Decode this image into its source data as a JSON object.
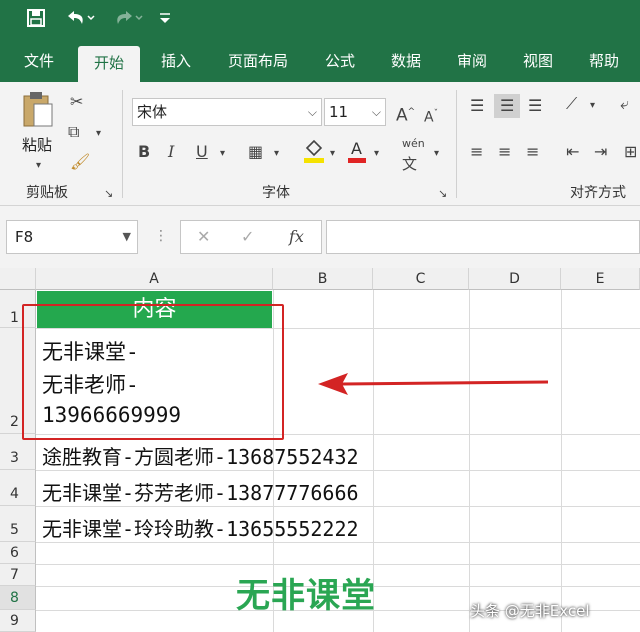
{
  "quick_access": {
    "save_icon": "save-icon",
    "undo_icon": "undo-icon",
    "redo_icon": "redo-icon",
    "customize_icon": "customize-icon"
  },
  "tabs": [
    {
      "label": "文件"
    },
    {
      "label": "开始",
      "active": true
    },
    {
      "label": "插入"
    },
    {
      "label": "页面布局"
    },
    {
      "label": "公式"
    },
    {
      "label": "数据"
    },
    {
      "label": "审阅"
    },
    {
      "label": "视图"
    },
    {
      "label": "帮助"
    }
  ],
  "ribbon": {
    "clipboard": {
      "paste_label": "粘贴",
      "group_label": "剪贴板"
    },
    "font": {
      "name": "宋体",
      "size": "11",
      "group_label": "字体",
      "bold": "B",
      "italic": "I",
      "underline": "U",
      "grow": "A",
      "shrink": "A",
      "font_color": "A",
      "phonetic": "wén"
    },
    "alignment": {
      "group_label": "对齐方式"
    }
  },
  "formula_bar": {
    "name_box": "F8",
    "fx": "fx",
    "formula": ""
  },
  "sheet": {
    "columns": [
      "A",
      "B",
      "C",
      "D",
      "E"
    ],
    "rows": [
      "1",
      "2",
      "3",
      "4",
      "5",
      "6",
      "7",
      "8",
      "9"
    ],
    "a1": "内容",
    "a2_lines": [
      "无非课堂-",
      "无非老师-",
      "13966669999"
    ],
    "a3": "途胜教育-方圆老师-13687552432",
    "a4": "无非课堂-芬芳老师-13877776666",
    "a5": "无非课堂-玲玲助教-13655552222"
  },
  "watermark": "无非课堂",
  "credit": "头条 @无非Excel",
  "colors": {
    "excel_green": "#217346",
    "header_green": "#24a84e",
    "highlight_red": "#d32424"
  }
}
